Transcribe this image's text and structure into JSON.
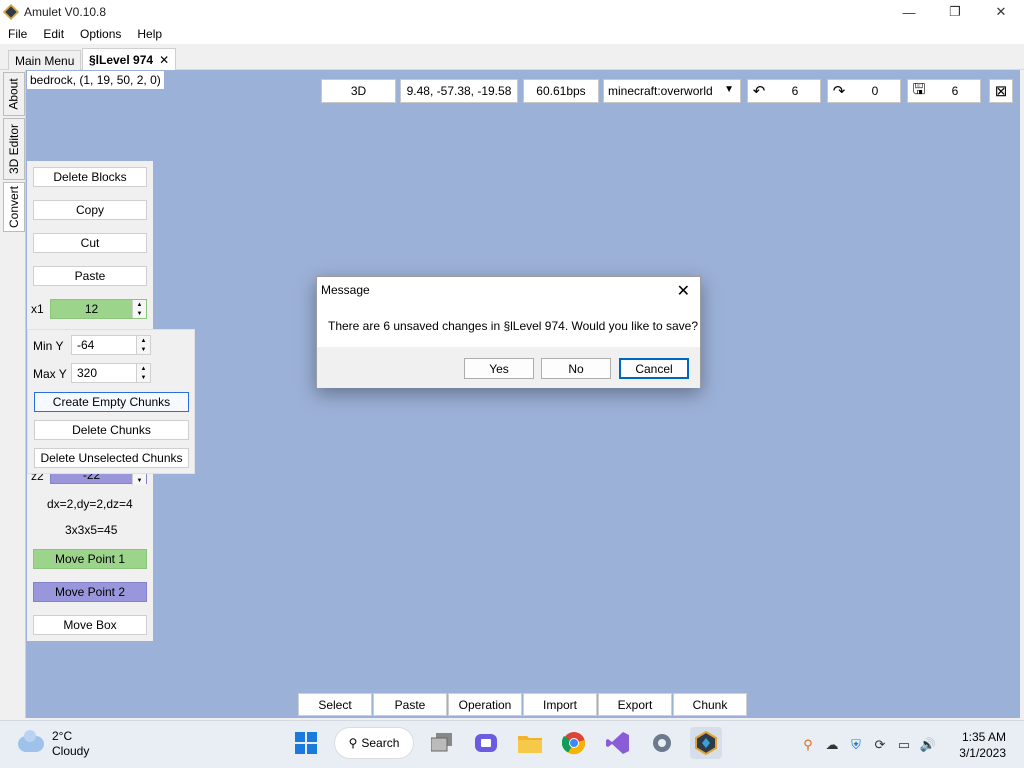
{
  "window": {
    "title": "Amulet V0.10.8",
    "min_icon": "—",
    "restore_icon": "❐",
    "close_icon": "✕"
  },
  "menubar": {
    "items": [
      "File",
      "Edit",
      "Options",
      "Help"
    ]
  },
  "tabs": [
    {
      "label": "Main Menu"
    },
    {
      "label": "§lLevel 974",
      "close": "✕"
    }
  ],
  "sidetabs": [
    "About",
    "3D Editor",
    "Convert"
  ],
  "canvas": {
    "block_label": "bedrock, (1, 19, 50, 2, 0)",
    "view_mode": "3D",
    "camera_pos": "9.48, -57.38, -19.58",
    "speed": "60.61bps",
    "dimension": "minecraft:overworld",
    "undo_count": "6",
    "redo_count": "0",
    "save_count": "6",
    "undo_icon": "↶",
    "redo_icon": "↷",
    "save_icon": "🖫",
    "close_icon": "⊠"
  },
  "left_panel": {
    "delete_blocks": "Delete Blocks",
    "copy": "Copy",
    "cut": "Cut",
    "paste": "Paste",
    "multiplier_label": "x1",
    "multiplier_value": "12",
    "z2_label": "z2",
    "z2_value": "-22",
    "dims": "dx=2,dy=2,dz=4",
    "volume": "3x3x5=45",
    "move_point_1": "Move Point 1",
    "move_point_2": "Move Point 2",
    "move_box": "Move Box"
  },
  "chunk_panel": {
    "min_y_label": "Min Y",
    "min_y_value": "-64",
    "max_y_label": "Max Y",
    "max_y_value": "320",
    "create_empty": "Create Empty Chunks",
    "delete_chunks": "Delete Chunks",
    "delete_unselected": "Delete Unselected Chunks"
  },
  "dialog": {
    "title": "Message",
    "close_icon": "✕",
    "message": "There are 6 unsaved changes in §lLevel 974. Would you like to save?",
    "yes": "Yes",
    "no": "No",
    "cancel": "Cancel"
  },
  "bottom_toolbar": [
    "Select",
    "Paste",
    "Operation",
    "Import",
    "Export",
    "Chunk"
  ],
  "taskbar": {
    "temperature": "2°C",
    "condition": "Cloudy",
    "search": "Search",
    "time": "1:35 AM",
    "date": "3/1/2023"
  },
  "colors": {
    "canvas_bg": "#9cb1d8",
    "point1": "#9bd48a",
    "point2": "#9a96dc",
    "accent": "#0067c0"
  }
}
